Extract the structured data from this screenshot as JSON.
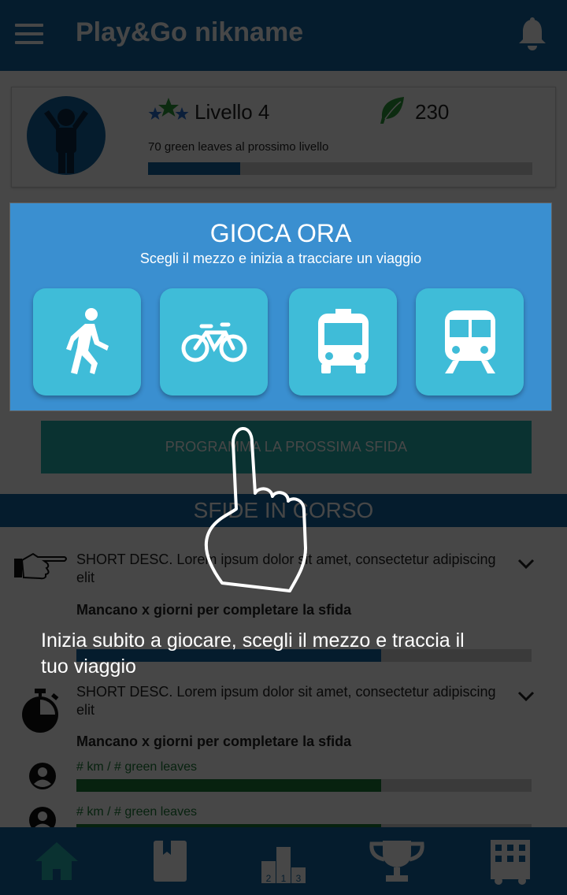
{
  "header": {
    "title": "Play&Go nikname"
  },
  "profile": {
    "level_label": "Livello 4",
    "leaves": "230",
    "next_level_text": "70 green leaves al prossimo livello",
    "progress": 0.24
  },
  "play": {
    "title": "GIOCA ORA",
    "subtitle": "Scegli il mezzo e inizia a tracciare un viaggio",
    "modes": [
      {
        "icon": "walk-icon"
      },
      {
        "icon": "bike-icon"
      },
      {
        "icon": "bus-icon"
      },
      {
        "icon": "train-icon"
      }
    ]
  },
  "challenge_button": "PROGRAMMA LA PROSSIMA SFIDA",
  "section_title": "SFIDE IN CORSO",
  "challenges": [
    {
      "icon": "pointing-hand-icon",
      "desc": "SHORT DESC. Lorem ipsum dolor sit amet, consectetur adipiscing elit",
      "days": "Mancano x giorni per completare la sfida",
      "progress": 0.67
    },
    {
      "icon": "stopwatch-icon",
      "desc": "SHORT DESC. Lorem ipsum dolor sit amet, consectetur adipiscing elit",
      "days": "Mancano x giorni per completare la sfida",
      "metrics": [
        {
          "label": "# km / # green leaves",
          "progress": 0.67
        },
        {
          "label": "# km / # green leaves",
          "progress": 0.67
        }
      ]
    }
  ],
  "overlay": {
    "hint": "Inizia subito a giocare, scegli il mezzo e traccia il tuo viaggio"
  },
  "nav": [
    "home-icon",
    "diary-icon",
    "ranking-icon",
    "trophy-icon",
    "city-icon"
  ],
  "colors": {
    "primary": "#1565a0",
    "panel": "#3a8fd0",
    "mode_button": "#3fbcd8",
    "teal": "#26b3b0",
    "green": "#1b7a36"
  }
}
